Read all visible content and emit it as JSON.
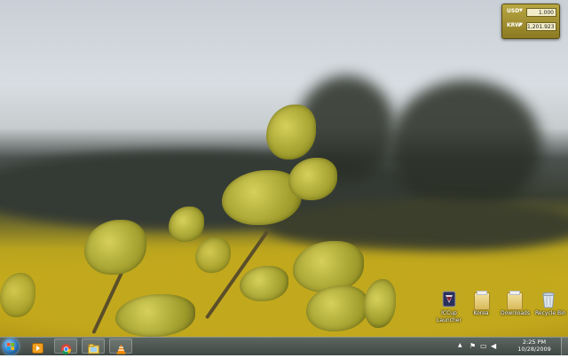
{
  "gadget": {
    "rows": [
      {
        "code": "USD",
        "value": "1.000"
      },
      {
        "code": "KRW",
        "value": "1,201.923"
      }
    ]
  },
  "desktop_icons": [
    {
      "label": "ICCup Launcher",
      "icon": "iccup-launcher-icon"
    },
    {
      "label": "Korea",
      "icon": "folder-icon"
    },
    {
      "label": "Downloads",
      "icon": "folder-icon"
    },
    {
      "label": "Recycle Bin",
      "icon": "recycle-bin-icon"
    }
  ],
  "taskbar": {
    "pinned": [
      {
        "name": "windows-media-player-icon"
      },
      {
        "name": "chrome-icon"
      },
      {
        "name": "explorer-icon"
      },
      {
        "name": "vlc-icon"
      }
    ],
    "clock": {
      "time": "2:25 PM",
      "date": "10/28/2009"
    }
  },
  "colors": {
    "gadget_gold": "#b9a743",
    "taskbar": "#4a5350"
  }
}
